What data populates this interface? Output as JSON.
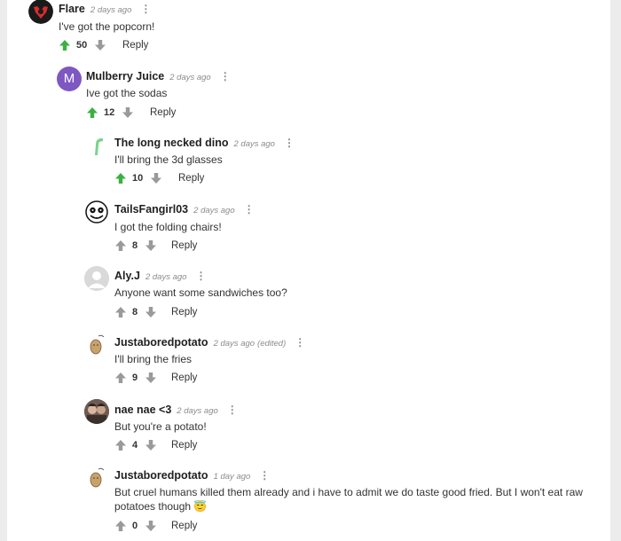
{
  "comments": [
    {
      "user": "Flare",
      "time": "2 days ago",
      "edited": "",
      "text": "I've got the popcorn!",
      "score": "50",
      "reply": "Reply",
      "upvoted": true,
      "avatar": "flare-avatar-icon"
    },
    {
      "user": "Mulberry Juice",
      "time": "2 days ago",
      "edited": "",
      "text": "Ive got the sodas",
      "score": "12",
      "reply": "Reply",
      "upvoted": true,
      "avatar": "letter-m-avatar-icon",
      "avatar_letter": "M"
    },
    {
      "user": "The long necked dino",
      "time": "2 days ago",
      "edited": "",
      "text": "I'll bring the 3d glasses",
      "score": "10",
      "reply": "Reply",
      "upvoted": true,
      "avatar": "dino-avatar-icon"
    },
    {
      "user": "TailsFangirl03",
      "time": "2 days ago",
      "edited": "",
      "text": "I got the folding chairs!",
      "score": "8",
      "reply": "Reply",
      "upvoted": false,
      "avatar": "skull-avatar-icon"
    },
    {
      "user": "Aly.J",
      "time": "2 days ago",
      "edited": "",
      "text": "Anyone want some sandwiches too?",
      "score": "8",
      "reply": "Reply",
      "upvoted": false,
      "avatar": "default-user-avatar-icon"
    },
    {
      "user": "Justaboredpotato",
      "time": "2 days ago",
      "edited": "(edited)",
      "text": "I'll bring the fries",
      "score": "9",
      "reply": "Reply",
      "upvoted": false,
      "avatar": "potato-avatar-icon"
    },
    {
      "user": "nae nae <3",
      "time": "2 days ago",
      "edited": "",
      "text": "But you're a potato!",
      "score": "4",
      "reply": "Reply",
      "upvoted": false,
      "avatar": "photo-avatar-icon"
    },
    {
      "user": "Justaboredpotato",
      "time": "1 day ago",
      "edited": "",
      "text": "But cruel humans killed them already and i have to admit we do taste good fried. But I won't eat raw potatoes though 😇",
      "score": "0",
      "reply": "Reply",
      "upvoted": false,
      "avatar": "potato-avatar-icon"
    }
  ],
  "colors": {
    "upvote_active": "#3cb043",
    "vote_inactive": "#9a9a9a",
    "avatar_m": "#7e57c2"
  }
}
